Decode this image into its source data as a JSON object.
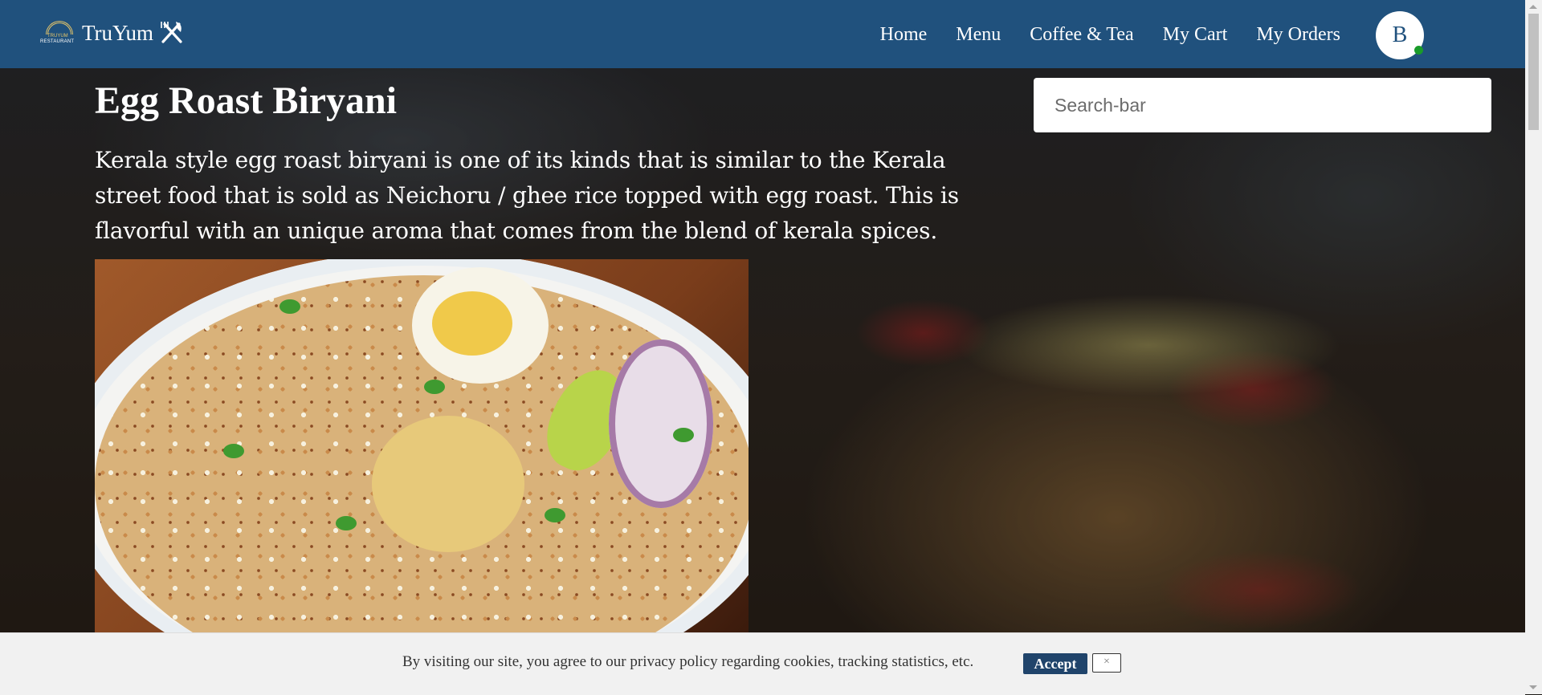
{
  "brand": {
    "name": "TruYum",
    "logo_text_top": "TRUYUM",
    "logo_text_bottom": "RESTAURANT",
    "icon": "fork-knife-icon"
  },
  "nav": {
    "items": [
      "Home",
      "Menu",
      "Coffee & Tea",
      "My Cart",
      "My Orders"
    ]
  },
  "user": {
    "initial": "B",
    "status_color": "#1a9b2a"
  },
  "search": {
    "placeholder": "Search-bar",
    "value": ""
  },
  "dish": {
    "title": "Egg Roast Biryani",
    "description": "Kerala style egg roast biryani is one of its kinds that is similar to the Kerala street food that is sold as Neichoru / ghee rice topped with egg roast. This is flavorful with an unique aroma that comes from the blend of kerala spices."
  },
  "cookie_bar": {
    "message": "By visiting our site, you agree to our privacy policy regarding cookies, tracking statistics, etc.",
    "accept_label": "Accept",
    "close_label": "×"
  },
  "colors": {
    "header": "#20517d",
    "accept_button": "#20446b",
    "cookie_bar": "#f1f1f1"
  }
}
